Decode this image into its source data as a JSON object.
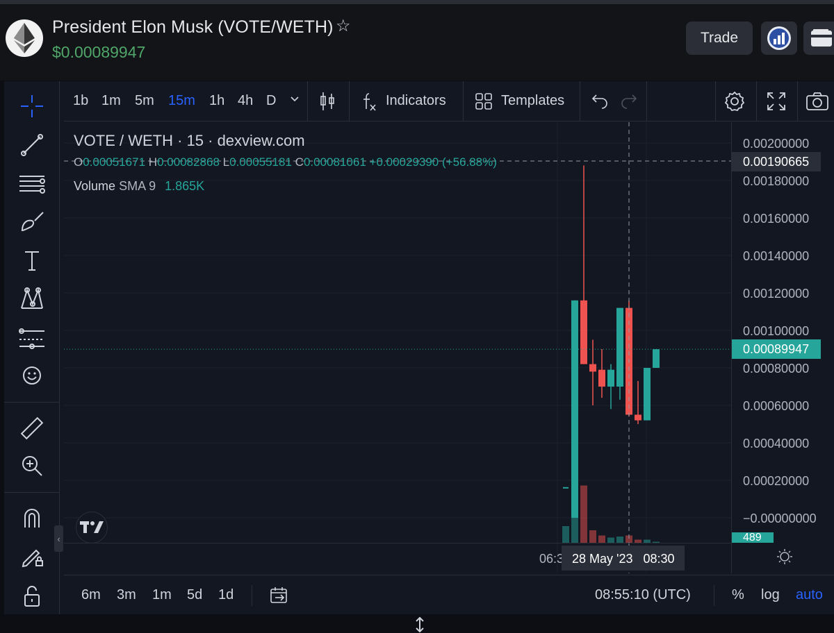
{
  "header": {
    "pair_title": "President Elon Musk (VOTE/WETH)",
    "price": "$0.00089947",
    "trade_label": "Trade"
  },
  "toolbar": {
    "intervals": [
      "1b",
      "1m",
      "5m",
      "15m",
      "1h",
      "4h",
      "D"
    ],
    "active_interval": "15m",
    "indicators_label": "Indicators",
    "templates_label": "Templates"
  },
  "legend": {
    "title": "VOTE / WETH · 15 · dexview.com",
    "o_label": "O",
    "o": "0.00051671",
    "h_label": "H",
    "h": "0.00082868",
    "l_label": "L",
    "l": "0.00055181",
    "c_label": "C",
    "c": "0.00081061",
    "change": "+0.00029390 (+56.88%)",
    "volume_label": "Volume",
    "sma_label": "SMA 9",
    "volume_value": "1.865K"
  },
  "price_axis": {
    "labels": [
      "0.00200000",
      "0.00180000",
      "0.00160000",
      "0.00140000",
      "0.00120000",
      "0.00100000",
      "0.00080000",
      "0.00060000",
      "0.00040000",
      "0.00020000",
      "−0.00000000"
    ],
    "crosshair_price": "0.00190665",
    "last_price": "0.00089947",
    "volume_tag": "489"
  },
  "time_axis": {
    "left_label": "06:3",
    "crosshair_time": "28 May '23   08:30"
  },
  "bottom": {
    "ranges": [
      "6m",
      "3m",
      "1m",
      "5d",
      "1d"
    ],
    "clock": "08:55:10 (UTC)",
    "percent_label": "%",
    "log_label": "log",
    "auto_label": "auto"
  },
  "chart_data": {
    "type": "candlestick",
    "interval": "15m",
    "candles": [
      {
        "o": 0.0,
        "h": 0.0,
        "l": 0.0,
        "c": 0.0
      },
      {
        "o": 0.0,
        "h": 0.00116,
        "l": 0.0,
        "c": 0.00116
      },
      {
        "o": 0.00116,
        "h": 0.00188,
        "l": 0.00082,
        "c": 0.00082
      },
      {
        "o": 0.00082,
        "h": 0.00095,
        "l": 0.0006,
        "c": 0.00078
      },
      {
        "o": 0.00079,
        "h": 0.0009,
        "l": 0.00064,
        "c": 0.0007
      },
      {
        "o": 0.0007,
        "h": 0.00082,
        "l": 0.00058,
        "c": 0.00079
      },
      {
        "o": 0.0007,
        "h": 0.00112,
        "l": 0.00063,
        "c": 0.00112
      },
      {
        "o": 0.00112,
        "h": 0.00116,
        "l": 0.00054,
        "c": 0.00055
      },
      {
        "o": 0.00055,
        "h": 0.00073,
        "l": 0.0005,
        "c": 0.00052
      },
      {
        "o": 0.00052,
        "h": 0.0008,
        "l": 0.00052,
        "c": 0.0008
      },
      {
        "o": 0.0008,
        "h": 0.0009,
        "l": 0.0008,
        "c": 0.00089947
      }
    ],
    "volume": [
      0.16,
      1.2,
      0.55,
      0.12,
      0.07,
      0.05,
      0.06,
      0.07,
      0.03,
      0.03,
      0.01
    ],
    "yaxis_ticks": [
      "0.00200000",
      "0.00180000",
      "0.00160000",
      "0.00140000",
      "0.00120000",
      "0.00100000",
      "0.00080000",
      "0.00060000",
      "0.00040000",
      "0.00020000",
      "−0.00000000"
    ],
    "up_color": "#26a69a",
    "down_color": "#ef5350"
  }
}
